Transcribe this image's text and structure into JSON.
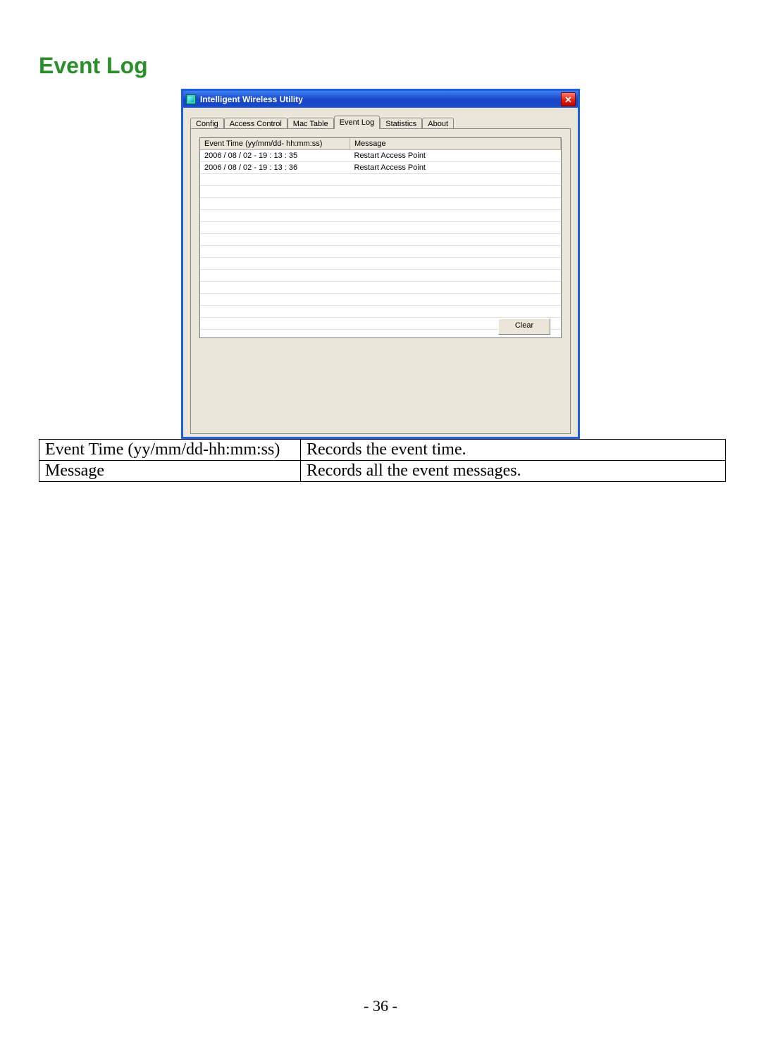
{
  "heading": "Event Log",
  "window": {
    "title": "Intelligent Wireless Utility",
    "close_glyph": "✕",
    "tabs": [
      "Config",
      "Access Control",
      "Mac Table",
      "Event Log",
      "Statistics",
      "About"
    ],
    "active_tab_index": 3,
    "columns": {
      "time": "Event Time (yy/mm/dd- hh:mm:ss)",
      "msg": "Message"
    },
    "rows": [
      {
        "time": "2006 / 08 / 02 - 19 : 13 : 35",
        "msg": "Restart Access Point"
      },
      {
        "time": "2006 / 08 / 02 - 19 : 13 : 36",
        "msg": "Restart Access Point"
      }
    ],
    "blank_row_count": 16,
    "clear_label": "Clear"
  },
  "doc_table": {
    "rows": [
      {
        "k": "Event Time (yy/mm/dd-hh:mm:ss)",
        "v": "Records the event time."
      },
      {
        "k": "Message",
        "v": "Records all the event messages."
      }
    ]
  },
  "page_number": "- 36 -"
}
